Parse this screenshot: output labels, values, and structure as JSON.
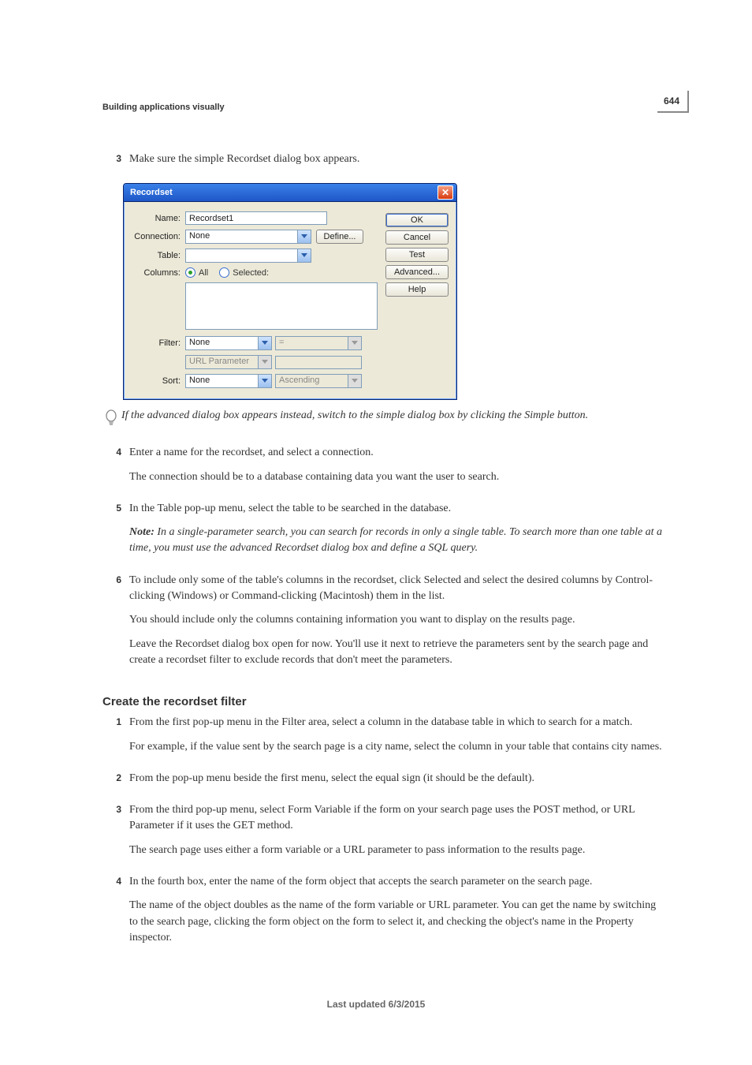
{
  "page_number": "644",
  "running_head": "Building applications visually",
  "intro_step": {
    "num": "3",
    "text": "Make sure the simple Recordset dialog box appears."
  },
  "dialog": {
    "title": "Recordset",
    "labels": {
      "name": "Name:",
      "connection": "Connection:",
      "table": "Table:",
      "columns": "Columns:",
      "filter": "Filter:",
      "sort": "Sort:"
    },
    "name_value": "Recordset1",
    "connection_value": "None",
    "table_value": "",
    "radio_all": "All",
    "radio_selected": "Selected:",
    "filter_col_value": "None",
    "filter_op_value": "=",
    "filter_type_value": "URL Parameter",
    "filter_val_value": "",
    "sort_col_value": "None",
    "sort_dir_value": "Ascending",
    "define_btn": "Define...",
    "buttons": {
      "ok": "OK",
      "cancel": "Cancel",
      "test": "Test",
      "advanced": "Advanced...",
      "help": "Help"
    }
  },
  "tip_text": "If the advanced dialog box appears instead, switch to the simple dialog box by clicking the Simple button.",
  "steps_after": [
    {
      "num": "4",
      "paras": [
        "Enter a name for the recordset, and select a connection.",
        "The connection should be to a database containing data you want the user to search."
      ]
    },
    {
      "num": "5",
      "paras": [
        "In the Table pop-up menu, select the table to be searched in the database."
      ],
      "note": "In a single-parameter search, you can search for records in only a single table. To search more than one table at a time, you must use the advanced Recordset dialog box and define a SQL query."
    },
    {
      "num": "6",
      "paras": [
        "To include only some of the table's columns in the recordset, click Selected and select the desired columns by Control-clicking (Windows) or Command-clicking (Macintosh) them in the list.",
        "You should include only the columns containing information you want to display on the results page.",
        "Leave the Recordset dialog box open for now. You'll use it next to retrieve the parameters sent by the search page and create a recordset filter to exclude records that don't meet the parameters."
      ]
    }
  ],
  "subhead": "Create the recordset filter",
  "filter_steps": [
    {
      "num": "1",
      "paras": [
        "From the first pop-up menu in the Filter area, select a column in the database table in which to search for a match.",
        "For example, if the value sent by the search page is a city name, select the column in your table that contains city names."
      ]
    },
    {
      "num": "2",
      "paras": [
        "From the pop-up menu beside the first menu, select the equal sign (it should be the default)."
      ]
    },
    {
      "num": "3",
      "paras": [
        "From the third pop-up menu, select Form Variable if the form on your search page uses the POST method, or URL Parameter if it uses the GET method.",
        "The search page uses either a form variable or a URL parameter to pass information to the results page."
      ]
    },
    {
      "num": "4",
      "paras": [
        "In the fourth box, enter the name of the form object that accepts the search parameter on the search page.",
        "The name of the object doubles as the name of the form variable or URL parameter. You can get the name by switching to the search page, clicking the form object on the form to select it, and checking the object's name in the Property inspector."
      ]
    }
  ],
  "footer": "Last updated 6/3/2015"
}
